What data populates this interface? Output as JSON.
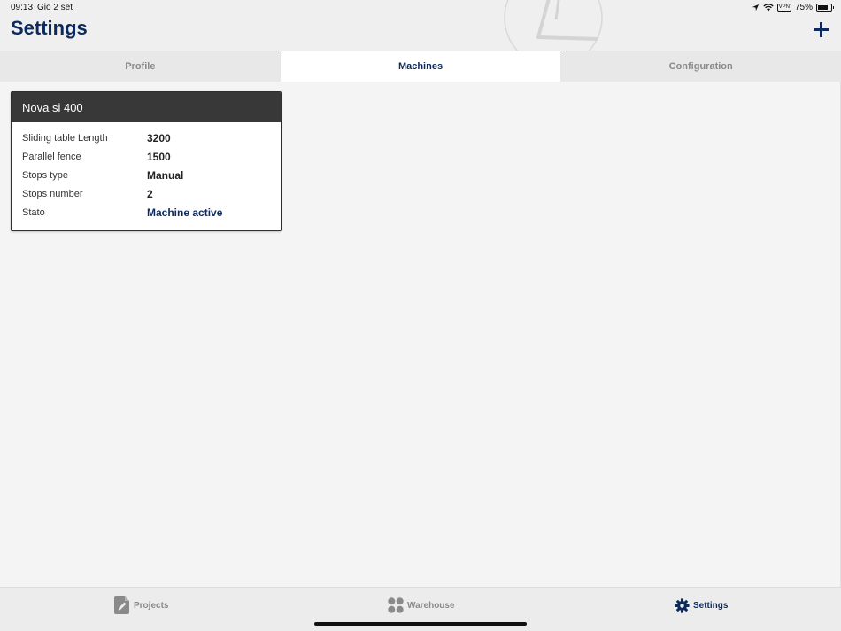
{
  "status_bar": {
    "time": "09:13",
    "date": "Gio 2 set",
    "vpn": "VPN",
    "battery": "75%",
    "battery_level": 0.75,
    "icons": [
      "location-icon",
      "wifi-icon",
      "vpn-icon",
      "battery-icon"
    ]
  },
  "header": {
    "title": "Settings",
    "add_icon": "plus-icon"
  },
  "tabs": [
    {
      "label": "Profile",
      "active": false
    },
    {
      "label": "Machines",
      "active": true
    },
    {
      "label": "Configuration",
      "active": false
    }
  ],
  "machine_card": {
    "name": "Nova si 400",
    "specs": [
      {
        "label": "Sliding table Length",
        "value": "3200"
      },
      {
        "label": "Parallel fence",
        "value": "1500"
      },
      {
        "label": "Stops type",
        "value": "Manual"
      },
      {
        "label": "Stops number",
        "value": "2"
      },
      {
        "label": "Stato",
        "value": "Machine active"
      }
    ]
  },
  "tabbar": {
    "items": [
      {
        "label": "Projects",
        "icon": "document-edit-icon",
        "active": false
      },
      {
        "label": "Warehouse",
        "icon": "dots-grid-icon",
        "active": false
      },
      {
        "label": "Settings",
        "icon": "gear-icon",
        "active": true
      }
    ]
  },
  "colors": {
    "accent": "#0c2a5e",
    "inactive": "#8a8a8a",
    "card_header": "#383838",
    "background": "#f4f4f4"
  }
}
